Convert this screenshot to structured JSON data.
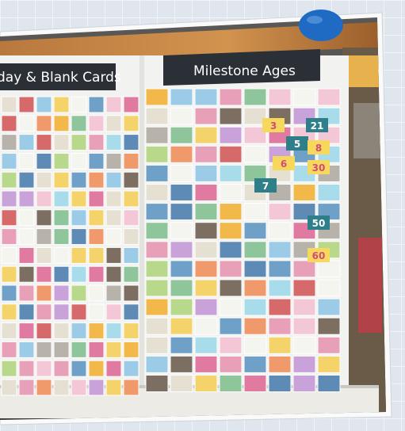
{
  "signs": {
    "left": "day & Blank Cards",
    "right": "Milestone Ages"
  },
  "card_numbers": [
    "3",
    "5",
    "6",
    "7",
    "8",
    "50",
    "60",
    "21",
    "30"
  ],
  "colors": {
    "pin": "#1f6bc4",
    "sign_background": "#2b2f36",
    "frame": "#f2f2f0",
    "shelf_wood": "#c98a4a"
  }
}
